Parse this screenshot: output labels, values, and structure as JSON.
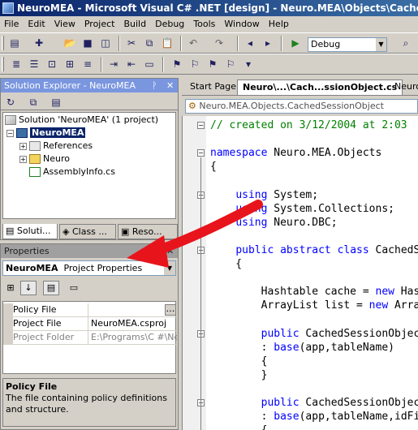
{
  "window": {
    "title": "NeuroMEA - Microsoft Visual C# .NET [design] - Neuro.MEA\\Objects\\CachedSessionObject.cs"
  },
  "menu": [
    "File",
    "Edit",
    "View",
    "Project",
    "Build",
    "Debug",
    "Tools",
    "Window",
    "Help"
  ],
  "toolbar": {
    "config": "Debug"
  },
  "solution_explorer": {
    "title": "Solution Explorer - NeuroMEA",
    "tree": [
      {
        "label": "Solution 'NeuroMEA' (1 project)",
        "icon": "solution-icon"
      },
      {
        "label": "NeuroMEA",
        "icon": "csharp-project-icon",
        "selected": true
      },
      {
        "label": "References",
        "icon": "references-icon"
      },
      {
        "label": "Neuro",
        "icon": "folder-icon"
      },
      {
        "label": "AssemblyInfo.cs",
        "icon": "cs-file-icon"
      }
    ],
    "tabs": [
      "Soluti...",
      "Class ...",
      "Reso..."
    ]
  },
  "properties": {
    "title": "Properties",
    "object": "NeuroMEA",
    "object_type": "Project Properties",
    "rows": [
      {
        "name": "Policy File",
        "value": ""
      },
      {
        "name": "Project File",
        "value": "NeuroMEA.csproj"
      },
      {
        "name": "Project Folder",
        "value": "E:\\Programs\\C #\\Neur"
      }
    ],
    "desc_title": "Policy File",
    "desc_text": "The file containing policy definitions and structure."
  },
  "editor": {
    "tabs": [
      "Start Page",
      "Neuro\\...\\Cach...ssionObject.cs",
      "Neuro"
    ],
    "nav": "Neuro.MEA.Objects.CachedSessionObject",
    "lines": [
      {
        "parts": [
          {
            "t": "// created on 3/12/2004 at 2:03",
            "c": "cm"
          }
        ]
      },
      {
        "parts": []
      },
      {
        "parts": [
          {
            "t": "namespace",
            "c": "kw"
          },
          {
            "t": " Neuro.MEA.Objects",
            "c": ""
          }
        ]
      },
      {
        "parts": [
          {
            "t": "{",
            "c": ""
          }
        ]
      },
      {
        "parts": []
      },
      {
        "parts": [
          {
            "t": "    ",
            "c": ""
          },
          {
            "t": "using",
            "c": "kw"
          },
          {
            "t": " System;",
            "c": ""
          }
        ]
      },
      {
        "parts": [
          {
            "t": "    ",
            "c": ""
          },
          {
            "t": "using",
            "c": "kw"
          },
          {
            "t": " System.Collections;",
            "c": ""
          }
        ]
      },
      {
        "parts": [
          {
            "t": "    ",
            "c": ""
          },
          {
            "t": "using",
            "c": "kw"
          },
          {
            "t": " Neuro.DBC;",
            "c": ""
          }
        ]
      },
      {
        "parts": []
      },
      {
        "parts": [
          {
            "t": "    ",
            "c": ""
          },
          {
            "t": "public",
            "c": "kw"
          },
          {
            "t": " ",
            "c": ""
          },
          {
            "t": "abstract",
            "c": "kw"
          },
          {
            "t": " ",
            "c": ""
          },
          {
            "t": "class",
            "c": "kw"
          },
          {
            "t": " CachedSessionObj",
            "c": ""
          }
        ]
      },
      {
        "parts": [
          {
            "t": "    {",
            "c": ""
          }
        ]
      },
      {
        "parts": []
      },
      {
        "parts": [
          {
            "t": "        Hashtable cache = ",
            "c": ""
          },
          {
            "t": "new",
            "c": "kw"
          },
          {
            "t": " Hashtable();",
            "c": ""
          }
        ]
      },
      {
        "parts": [
          {
            "t": "        ArrayList list = ",
            "c": ""
          },
          {
            "t": "new",
            "c": "kw"
          },
          {
            "t": " ArrayList();",
            "c": ""
          }
        ]
      },
      {
        "parts": []
      },
      {
        "parts": [
          {
            "t": "        ",
            "c": ""
          },
          {
            "t": "public",
            "c": "kw"
          },
          {
            "t": " CachedSessionObject(",
            "c": ""
          }
        ]
      },
      {
        "parts": [
          {
            "t": "        : ",
            "c": ""
          },
          {
            "t": "base",
            "c": "kw"
          },
          {
            "t": "(app,tableName)",
            "c": ""
          }
        ]
      },
      {
        "parts": [
          {
            "t": "        {",
            "c": ""
          }
        ]
      },
      {
        "parts": [
          {
            "t": "        }",
            "c": ""
          }
        ]
      },
      {
        "parts": []
      },
      {
        "parts": [
          {
            "t": "        ",
            "c": ""
          },
          {
            "t": "public",
            "c": "kw"
          },
          {
            "t": " CachedSessionObject(",
            "c": ""
          }
        ]
      },
      {
        "parts": [
          {
            "t": "        : ",
            "c": ""
          },
          {
            "t": "base",
            "c": "kw"
          },
          {
            "t": "(app,tableName,idField",
            "c": ""
          }
        ]
      },
      {
        "parts": [
          {
            "t": "        {",
            "c": ""
          }
        ]
      }
    ]
  },
  "colors": {
    "annotation_arrow": "#e8141c",
    "keyword": "#0000ff",
    "comment": "#008000",
    "active_header": "#7a96df"
  }
}
